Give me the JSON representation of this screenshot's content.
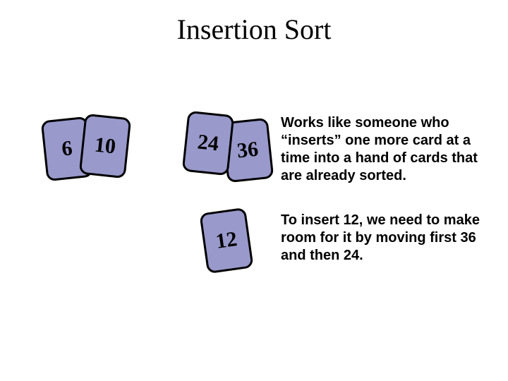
{
  "title": "Insertion Sort",
  "cards": {
    "c6": "6",
    "c10": "10",
    "c24": "24",
    "c36": "36",
    "c12": "12"
  },
  "paragraphs": {
    "p1": "Works like someone who “inserts” one more card at a time into a hand of cards that are already sorted.",
    "p2": "To insert 12, we need to make room for it by moving first 36 and then 24."
  }
}
